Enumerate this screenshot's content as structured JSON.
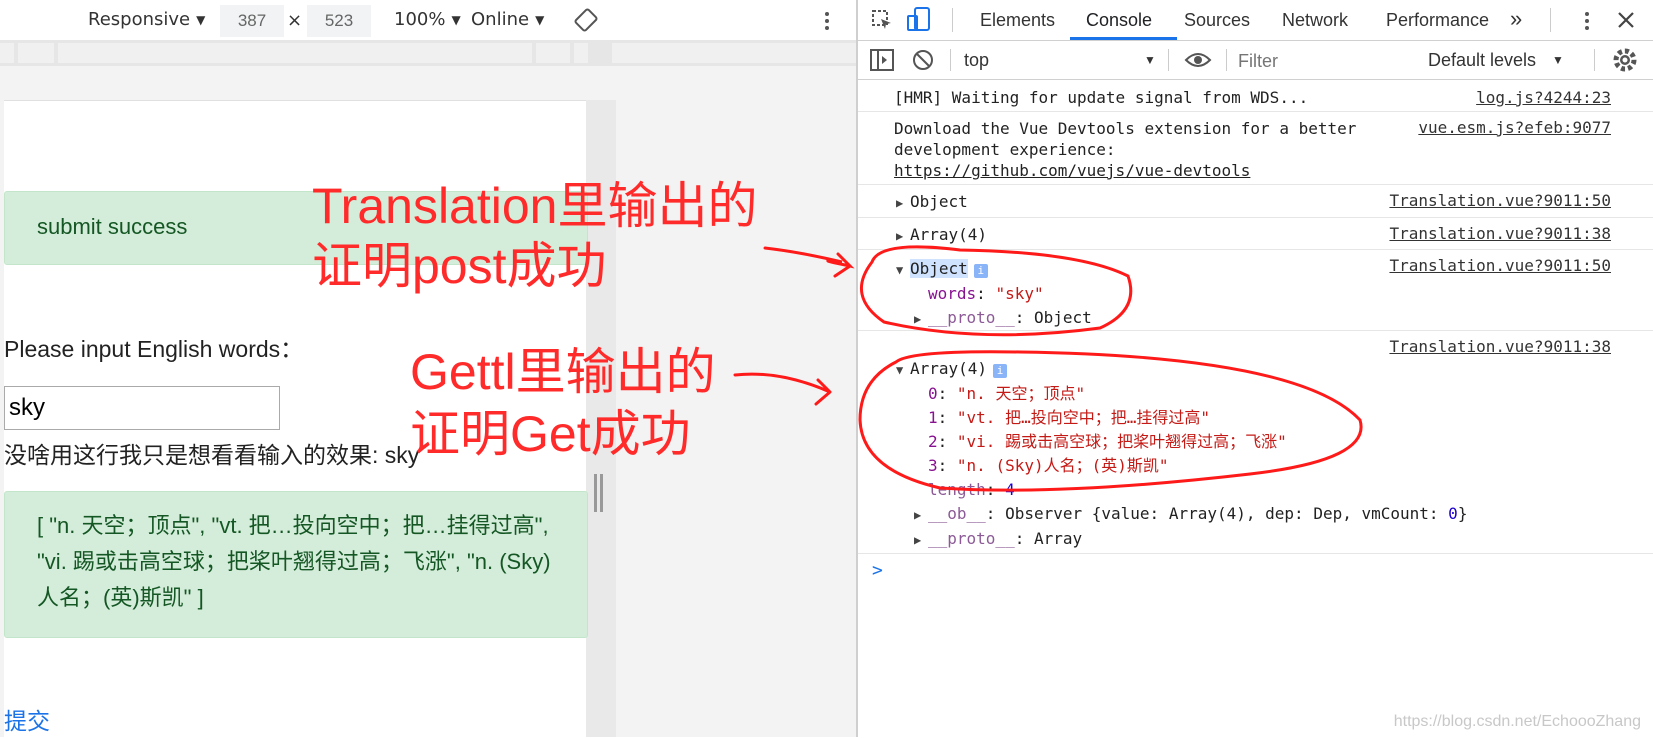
{
  "device_toolbar": {
    "device": "Responsive",
    "width": "387",
    "times": "×",
    "height": "523",
    "zoom": "100%",
    "network": "Online"
  },
  "page": {
    "alert_success": "submit success",
    "prompt_label": "Please input English words：",
    "input_value": "sky",
    "echo_line": "没啥用这行我只是想看看输入的效果: sky",
    "result_text": "[ \"n. 天空；顶点\", \"vt. 把…投向空中；把…挂得过高\", \"vi. 踢或击高空球；把桨叶翘得过高；飞涨\", \"n. (Sky)人名；(英)斯凯\" ]",
    "submit_link": "提交"
  },
  "annotations": {
    "translation_line1": "Translation里输出的",
    "translation_line2": "证明post成功",
    "gettl_line1": "Gettl里输出的",
    "gettl_line2": "证明Get成功",
    "color": "#ff2a2a"
  },
  "devtools": {
    "tabs": [
      "Elements",
      "Console",
      "Sources",
      "Network",
      "Performance"
    ],
    "active_tab": "Console",
    "context": "top",
    "filter_placeholder": "Filter",
    "levels": "Default levels",
    "accent": "#1a73e8"
  },
  "console": {
    "hmr": {
      "text": "[HMR] Waiting for update signal from WDS...",
      "src": "log.js?4244:23"
    },
    "vue": {
      "line1": "Download the Vue Devtools extension for a better",
      "line2": "development experience:",
      "link": "https://github.com/vuejs/vue-devtools",
      "src": "vue.esm.js?efeb:9077"
    },
    "obj1": {
      "label": "Object",
      "src": "Translation.vue?9011:50"
    },
    "arr1": {
      "label": "Array(4)",
      "src": "Translation.vue?9011:38"
    },
    "obj2": {
      "label": "Object",
      "src": "Translation.vue?9011:50",
      "key": "words",
      "sep": ": ",
      "value": "\"sky\"",
      "proto_key": "__proto__",
      "proto_value": ": Object"
    },
    "arr2": {
      "label": "Array(4)",
      "src": "Translation.vue?9011:38",
      "items": [
        {
          "idx": "0",
          "val": "\"n. 天空；顶点\""
        },
        {
          "idx": "1",
          "val": "\"vt. 把…投向空中；把…挂得过高\""
        },
        {
          "idx": "2",
          "val": "\"vi. 踢或击高空球；把桨叶翘得过高；飞涨\""
        },
        {
          "idx": "3",
          "val": "\"n. (Sky)人名；(英)斯凯\""
        }
      ],
      "length_key": "length",
      "length_val": "4",
      "ob_key": "__ob__",
      "ob_val_pre": ": Observer {value: Array(4), dep: Dep, vmCount: ",
      "ob_val_num": "0",
      "ob_val_post": "}",
      "proto_key": "__proto__",
      "proto_val": ": Array"
    },
    "prompt": ">"
  },
  "watermark": "https://blog.csdn.net/EchoooZhang"
}
